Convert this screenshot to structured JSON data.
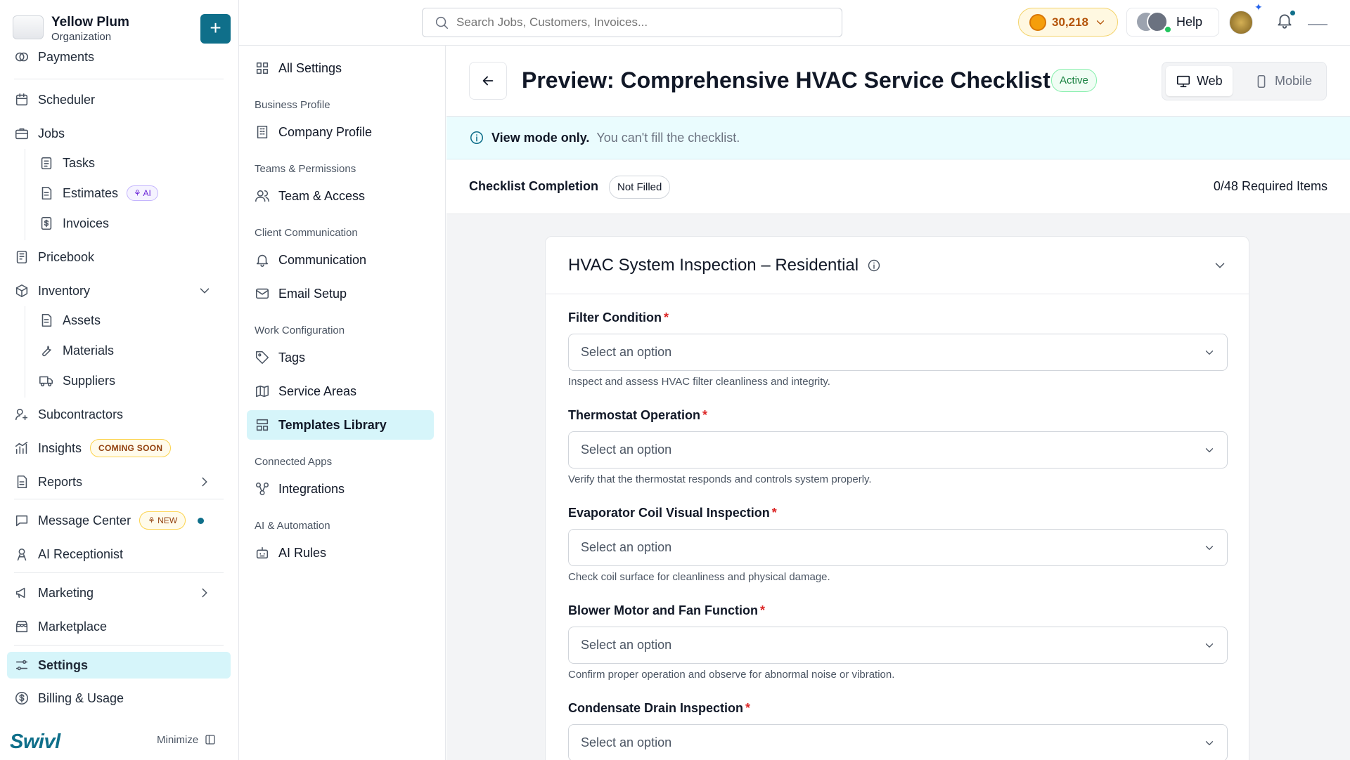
{
  "org": {
    "name": "Yellow Plum",
    "subtitle": "Organization",
    "add_label": "+"
  },
  "sidebar": {
    "payments": "Payments",
    "scheduler": "Scheduler",
    "jobs": "Jobs",
    "tasks": "Tasks",
    "estimates": "Estimates",
    "estimates_badge": "AI",
    "invoices": "Invoices",
    "pricebook": "Pricebook",
    "inventory": "Inventory",
    "assets": "Assets",
    "materials": "Materials",
    "suppliers": "Suppliers",
    "subcontractors": "Subcontractors",
    "insights": "Insights",
    "insights_badge": "COMING SOON",
    "reports": "Reports",
    "message_center": "Message Center",
    "message_badge": "NEW",
    "ai_receptionist": "AI Receptionist",
    "marketing": "Marketing",
    "marketplace": "Marketplace",
    "settings": "Settings",
    "billing": "Billing & Usage",
    "brand": "Swivl",
    "minimize": "Minimize"
  },
  "topbar": {
    "search_placeholder": "Search Jobs, Customers, Invoices...",
    "credits": "30,218",
    "help": "Help"
  },
  "settings_nav": {
    "all_settings": "All Settings",
    "groups": {
      "business_profile": "Business Profile",
      "teams": "Teams & Permissions",
      "client_comm": "Client Communication",
      "work_config": "Work Configuration",
      "connected_apps": "Connected Apps",
      "ai_automation": "AI & Automation"
    },
    "items": {
      "company_profile": "Company Profile",
      "team_access": "Team & Access",
      "communication": "Communication",
      "email_setup": "Email Setup",
      "tags": "Tags",
      "service_areas": "Service Areas",
      "templates_library": "Templates Library",
      "integrations": "Integrations",
      "ai_rules": "AI Rules"
    }
  },
  "main": {
    "title": "Preview: Comprehensive HVAC Service Checklist",
    "status": "Active",
    "view_web": "Web",
    "view_mobile": "Mobile",
    "info_bold": "View mode only.",
    "info_rest": "You can't fill the checklist.",
    "completion_label": "Checklist Completion",
    "completion_status": "Not Filled",
    "completion_count": "0/48 Required Items",
    "section_title": "HVAC System Inspection – Residential",
    "fields": [
      {
        "label": "Filter Condition",
        "placeholder": "Select an option",
        "help": "Inspect and assess HVAC filter cleanliness and integrity."
      },
      {
        "label": "Thermostat Operation",
        "placeholder": "Select an option",
        "help": "Verify that the thermostat responds and controls system properly."
      },
      {
        "label": "Evaporator Coil Visual Inspection",
        "placeholder": "Select an option",
        "help": "Check coil surface for cleanliness and physical damage."
      },
      {
        "label": "Blower Motor and Fan Function",
        "placeholder": "Select an option",
        "help": "Confirm proper operation and observe for abnormal noise or vibration."
      },
      {
        "label": "Condensate Drain Inspection",
        "placeholder": "Select an option",
        "help": ""
      }
    ]
  }
}
